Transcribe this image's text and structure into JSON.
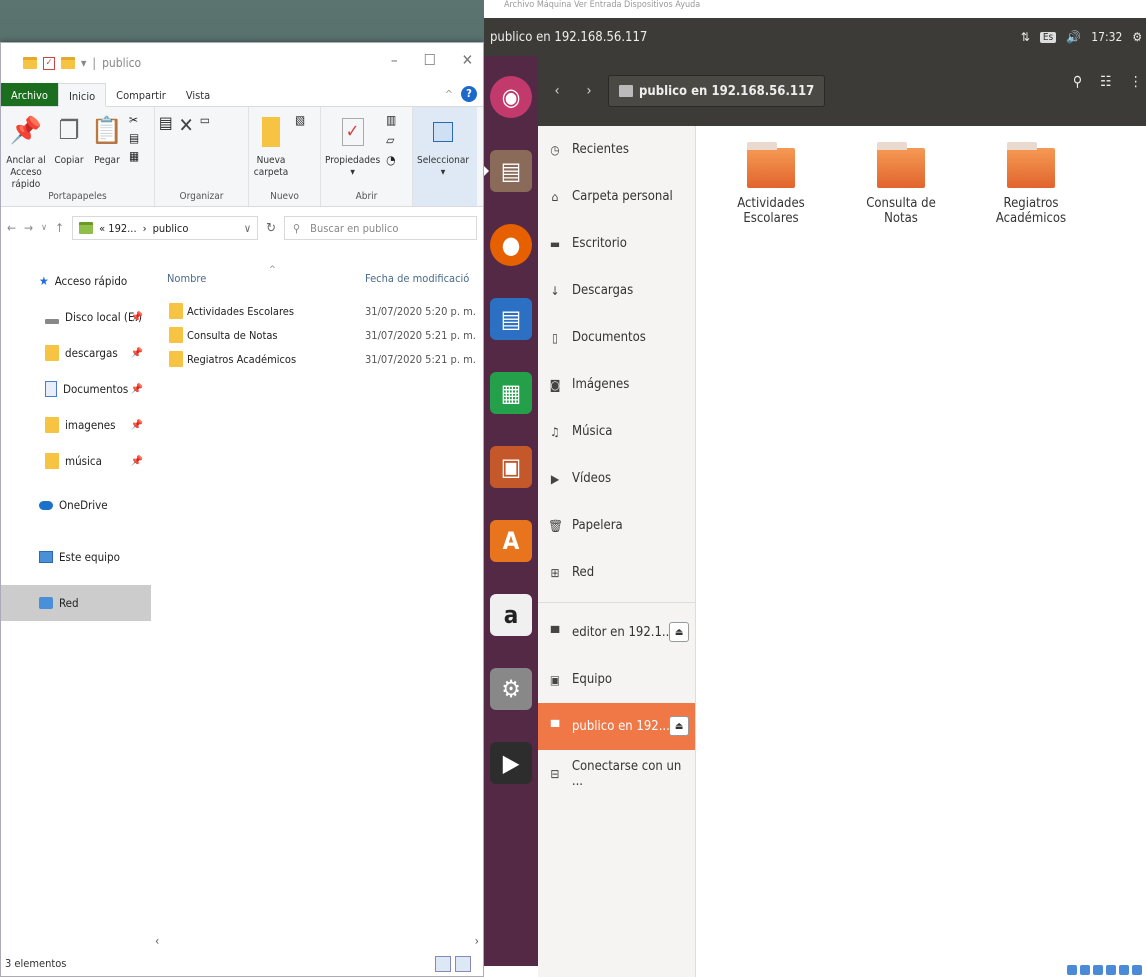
{
  "explorer": {
    "title": "publico",
    "tabs": [
      "Archivo",
      "Inicio",
      "Compartir",
      "Vista"
    ],
    "ribbon": {
      "portapapeles": {
        "label": "Portapapeles",
        "anclar": "Anclar al Acceso rápido",
        "copiar": "Copiar",
        "pegar": "Pegar"
      },
      "organizar": {
        "label": "Organizar"
      },
      "nuevo": {
        "label": "Nuevo",
        "nueva_carpeta": "Nueva carpeta"
      },
      "abrir": {
        "label": "Abrir",
        "propiedades": "Propiedades"
      },
      "seleccionar": "Seleccionar"
    },
    "address": {
      "path_prefix": "« 192...",
      "path_sep": "›",
      "path_current": "publico",
      "search_placeholder": "Buscar en publico"
    },
    "nav": {
      "quick_access": "Acceso rápido",
      "items": [
        "Disco local (E:)",
        "descargas",
        "Documentos",
        "imagenes",
        "música"
      ],
      "onedrive": "OneDrive",
      "this_pc": "Este equipo",
      "network": "Red"
    },
    "columns": {
      "name": "Nombre",
      "date": "Fecha de modificació"
    },
    "files": [
      {
        "name": "Actividades Escolares",
        "date": "31/07/2020 5:20 p. m."
      },
      {
        "name": "Consulta de Notas",
        "date": "31/07/2020 5:21 p. m."
      },
      {
        "name": "Regiatros Académicos",
        "date": "31/07/2020 5:21 p. m."
      }
    ],
    "status": "3 elementos"
  },
  "ubuntu": {
    "window_title": "publico en 192.168.56.117",
    "menu_bar": "Archivo  Máquina  Ver  Entrada  Dispositivos  Ayuda",
    "clock": "17:32",
    "lang": "Es",
    "path_label": "publico en 192.168.56.117",
    "sidebar": [
      {
        "label": "Recientes",
        "icon": "clock-icon"
      },
      {
        "label": "Carpeta personal",
        "icon": "home-icon"
      },
      {
        "label": "Escritorio",
        "icon": "desktop-icon"
      },
      {
        "label": "Descargas",
        "icon": "download-icon"
      },
      {
        "label": "Documentos",
        "icon": "document-icon"
      },
      {
        "label": "Imágenes",
        "icon": "camera-icon"
      },
      {
        "label": "Música",
        "icon": "music-icon"
      },
      {
        "label": "Vídeos",
        "icon": "video-icon"
      },
      {
        "label": "Papelera",
        "icon": "trash-icon"
      },
      {
        "label": "Red",
        "icon": "network-icon"
      }
    ],
    "mounts": [
      {
        "label": "editor en 192.1...",
        "icon": "network-drive-icon"
      },
      {
        "label": "Equipo",
        "icon": "computer-icon"
      },
      {
        "label": "publico en 192...",
        "icon": "network-drive-icon"
      },
      {
        "label": "Conectarse con un ...",
        "icon": "connect-icon"
      }
    ],
    "folders": [
      "Actividades Escolares",
      "Consulta de Notas",
      "Regiatros Académicos"
    ],
    "colors": {
      "accent": "#f07746",
      "launcher": "#532946",
      "topbar": "#3c3b37"
    }
  }
}
